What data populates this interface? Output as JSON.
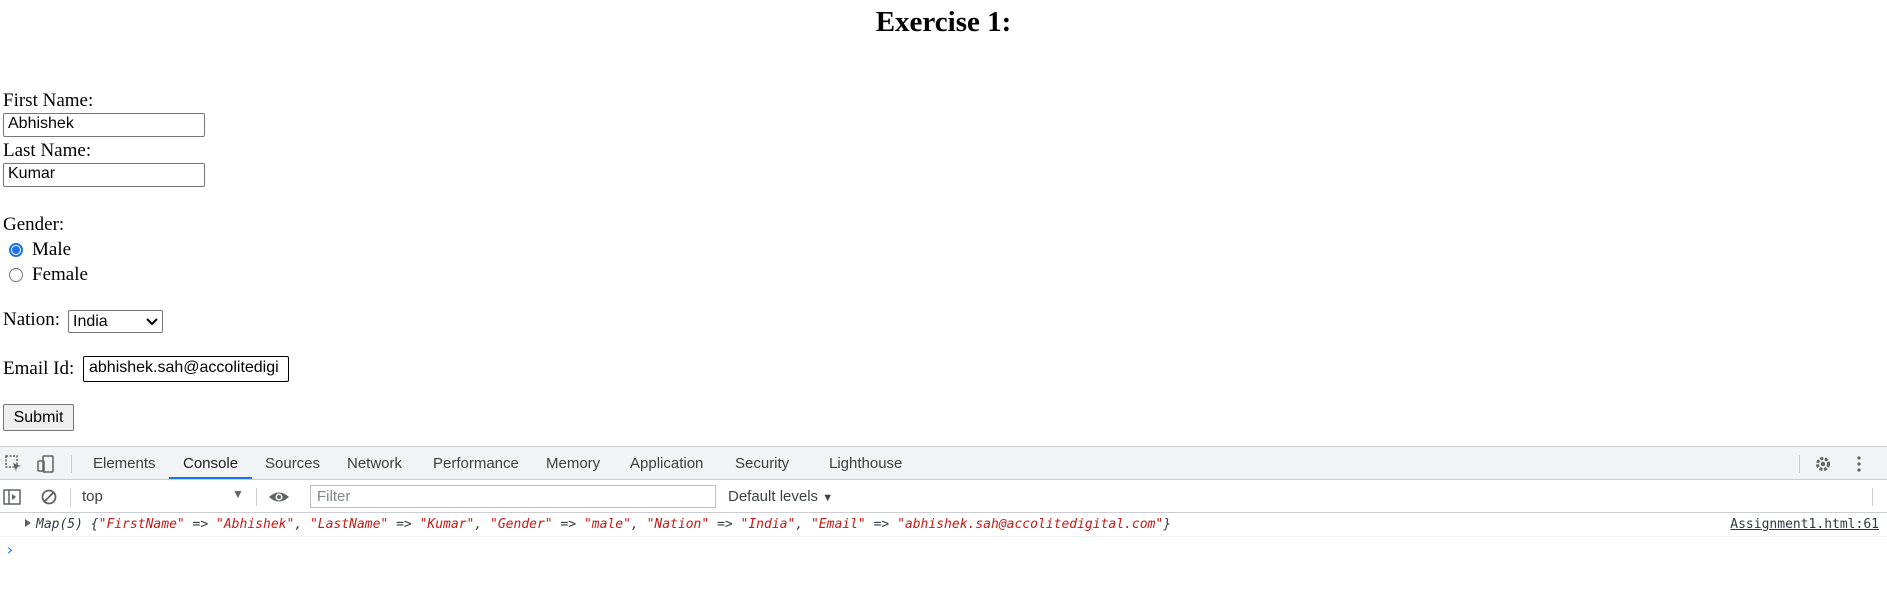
{
  "page": {
    "title": "Exercise 1:",
    "first_name_label": "First Name:",
    "first_name_value": "Abhishek",
    "last_name_label": "Last Name:",
    "last_name_value": "Kumar",
    "gender_label": "Gender:",
    "gender_options": [
      "Male",
      "Female"
    ],
    "gender_selected": "Male",
    "nation_label": "Nation:",
    "nation_value": "India",
    "email_label": "Email Id:",
    "email_value": "abhishek.sah@accolitedigi",
    "submit_label": "Submit"
  },
  "devtools": {
    "tabs": [
      "Elements",
      "Console",
      "Sources",
      "Network",
      "Performance",
      "Memory",
      "Application",
      "Security",
      "Lighthouse"
    ],
    "active_tab": "Console",
    "context": "top",
    "filter_placeholder": "Filter",
    "levels": "Default levels",
    "log": {
      "prefix": "Map(5) {",
      "entries": [
        {
          "key": "\"FirstName\"",
          "value": "\"Abhishek\""
        },
        {
          "key": "\"LastName\"",
          "value": "\"Kumar\""
        },
        {
          "key": "\"Gender\"",
          "value": "\"male\""
        },
        {
          "key": "\"Nation\"",
          "value": "\"India\""
        },
        {
          "key": "\"Email\"",
          "value": "\"abhishek.sah@accolitedigital.com\""
        }
      ],
      "suffix": "}",
      "source": "Assignment1.html:61"
    },
    "prompt": "›"
  },
  "colors": {
    "accent": "#1a73e8",
    "string": "#c41a16",
    "toolbar_bg": "#f1f3f4"
  }
}
